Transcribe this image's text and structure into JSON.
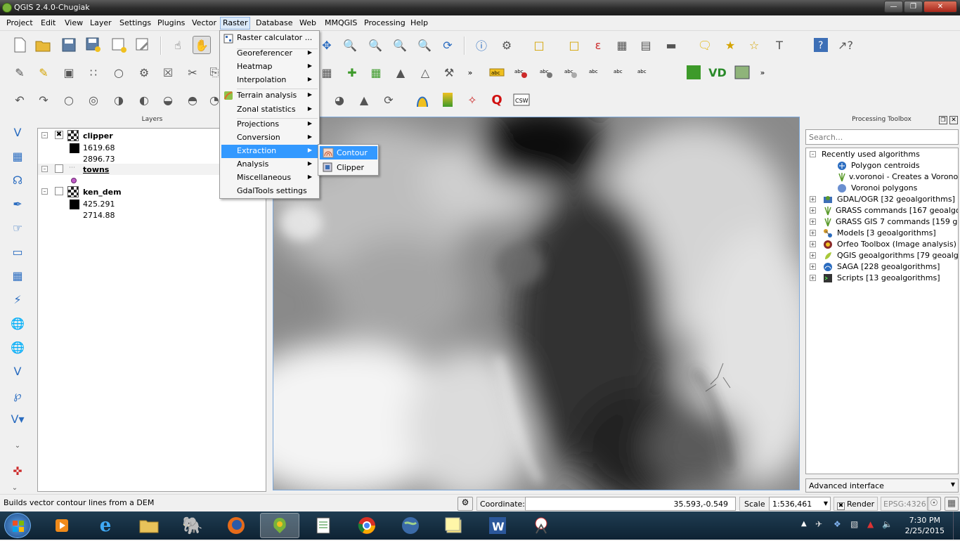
{
  "window": {
    "title": "QGIS 2.4.0-Chugiak"
  },
  "menubar": {
    "items": [
      "Project",
      "Edit",
      "View",
      "Layer",
      "Settings",
      "Plugins",
      "Vector",
      "Raster",
      "Database",
      "Web",
      "MMQGIS",
      "Processing",
      "Help"
    ]
  },
  "raster_menu": {
    "items": [
      {
        "label": "Raster calculator ..."
      },
      {
        "label": "Georeferencer"
      },
      {
        "label": "Heatmap"
      },
      {
        "label": "Interpolation"
      },
      {
        "label": "Terrain analysis"
      },
      {
        "label": "Zonal statistics"
      },
      {
        "label": "Projections"
      },
      {
        "label": "Conversion"
      },
      {
        "label": "Extraction"
      },
      {
        "label": "Analysis"
      },
      {
        "label": "Miscellaneous"
      },
      {
        "label": "GdalTools settings"
      }
    ],
    "submenu": {
      "items": [
        "Contour",
        "Clipper"
      ]
    }
  },
  "layers_panel": {
    "title": "Layers",
    "layers": [
      {
        "name": "clipper",
        "min": "1619.68",
        "max": "2896.73"
      },
      {
        "name": "towns"
      },
      {
        "name": "ken_dem",
        "min": "425.291",
        "max": "2714.88"
      }
    ]
  },
  "processing_toolbox": {
    "title": "Processing Toolbox",
    "search_placeholder": "Search...",
    "recent_header": "Recently used algorithms",
    "recent": [
      "Polygon centroids",
      "v.voronoi - Creates a Voronoi...",
      "Voronoi polygons"
    ],
    "providers": [
      "GDAL/OGR [32 geoalgorithms]",
      "GRASS commands [167 geoalgorit...",
      "GRASS GIS 7 commands [159 geo...",
      "Models [3 geoalgorithms]",
      "Orfeo Toolbox (Image analysis) [...",
      "QGIS geoalgorithms [79 geoalgor...",
      "SAGA [228 geoalgorithms]",
      "Scripts [13 geoalgorithms]"
    ],
    "mode": "Advanced interface"
  },
  "statusbar": {
    "message": "Builds vector contour lines from a DEM",
    "coord_label": "Coordinate:",
    "coord_value": "35.593,-0.549",
    "scale_label": "Scale",
    "scale_value": "1:536,461",
    "render_label": "Render",
    "crs": "EPSG:4326"
  },
  "taskbar": {
    "time": "7:30 PM",
    "date": "2/25/2015"
  },
  "toolbar": {
    "more_glyph": "»"
  }
}
